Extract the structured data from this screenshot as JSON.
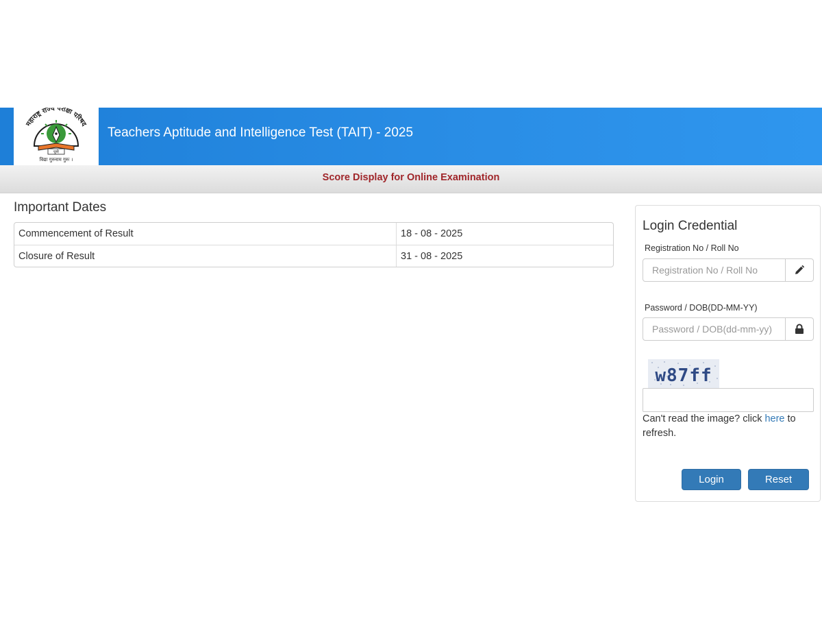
{
  "header": {
    "title": "Teachers Aptitude and Intelligence Test (TAIT) - 2025",
    "logo": {
      "arc_text": "महाराष्ट्र राज्य परीक्षा परिषद",
      "banner_text": "पुणे",
      "motto": "विद्या गुरुनाम गुरुः ।",
      "colors": {
        "green": "#3a9a3a",
        "orange": "#e8762b",
        "dark": "#1d1d1d"
      }
    }
  },
  "subheader": {
    "text": "Score Display for Online Examination"
  },
  "important_dates": {
    "title": "Important Dates",
    "rows": [
      {
        "label": "Commencement of Result",
        "value": "18 - 08 - 2025"
      },
      {
        "label": "Closure of Result",
        "value": "31 - 08 - 2025"
      }
    ]
  },
  "login": {
    "title": "Login Credential",
    "registration": {
      "label": "Registration No / Roll No",
      "placeholder": "Registration No / Roll No",
      "icon": "pencil-icon"
    },
    "password": {
      "label": "Password / DOB(DD-MM-YY)",
      "placeholder": "Password / DOB(dd-mm-yy)",
      "icon": "lock-icon"
    },
    "captcha": {
      "text": "w87ff",
      "input_value": ""
    },
    "refresh": {
      "prefix": "Can't read the image? click ",
      "link": "here",
      "suffix": " to refresh."
    },
    "buttons": {
      "login": "Login",
      "reset": "Reset"
    }
  },
  "colors": {
    "header_blue": "#2a8ee6",
    "subheader_text": "#a0262a",
    "button_blue": "#337ab7",
    "link_blue": "#337ab7"
  }
}
